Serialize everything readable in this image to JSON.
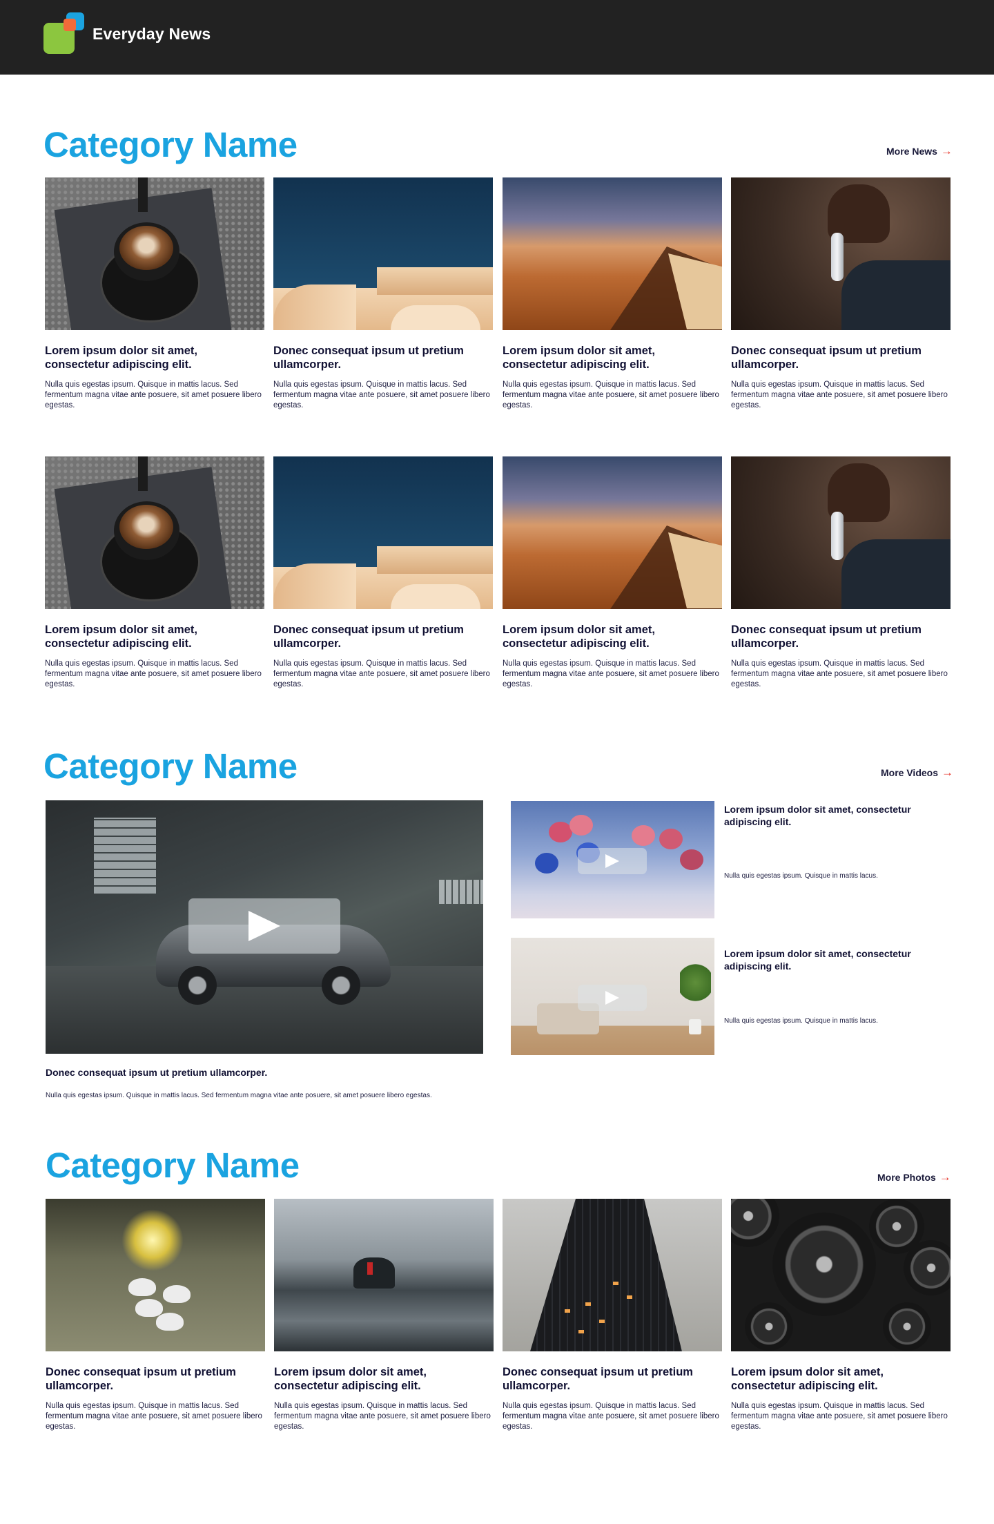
{
  "header": {
    "brand": "Everyday News"
  },
  "colors": {
    "accent": "#1aa3e0",
    "header_bg": "#222222",
    "arrow": "#e63329"
  },
  "news_section": {
    "title": "Category Name",
    "more_label": "More News",
    "rows": [
      [
        {
          "image": "coffee-cup",
          "title": "Lorem ipsum dolor sit amet, consectetur adipiscing elit.",
          "desc": "Nulla quis egestas ipsum. Quisque in mattis lacus. Sed fermentum magna vitae ante posuere, sit amet posuere libero egestas."
        },
        {
          "image": "beige-podium",
          "title": "Donec consequat ipsum ut pretium ullamcorper.",
          "desc": "Nulla quis egestas ipsum. Quisque in mattis lacus. Sed fermentum magna vitae ante posuere, sit amet posuere libero egestas."
        },
        {
          "image": "desert-dune",
          "title": "Lorem ipsum dolor sit amet, consectetur adipiscing elit.",
          "desc": "Nulla quis egestas ipsum. Quisque in mattis lacus. Sed fermentum magna vitae ante posuere, sit amet posuere libero egestas."
        },
        {
          "image": "hand-with-key",
          "title": "Donec consequat ipsum ut pretium ullamcorper.",
          "desc": "Nulla quis egestas ipsum. Quisque in mattis lacus. Sed fermentum magna vitae ante posuere, sit amet posuere libero egestas."
        }
      ],
      [
        {
          "image": "coffee-cup",
          "title": "Lorem ipsum dolor sit amet, consectetur adipiscing elit.",
          "desc": "Nulla quis egestas ipsum. Quisque in mattis lacus. Sed fermentum magna vitae ante posuere, sit amet posuere libero egestas."
        },
        {
          "image": "beige-podium",
          "title": "Donec consequat ipsum ut pretium ullamcorper.",
          "desc": "Nulla quis egestas ipsum. Quisque in mattis lacus. Sed fermentum magna vitae ante posuere, sit amet posuere libero egestas."
        },
        {
          "image": "desert-dune",
          "title": "Lorem ipsum dolor sit amet, consectetur adipiscing elit.",
          "desc": "Nulla quis egestas ipsum. Quisque in mattis lacus. Sed fermentum magna vitae ante posuere, sit amet posuere libero egestas."
        },
        {
          "image": "hand-with-key",
          "title": "Donec consequat ipsum ut pretium ullamcorper.",
          "desc": "Nulla quis egestas ipsum. Quisque in mattis lacus. Sed fermentum magna vitae ante posuere, sit amet posuere libero egestas."
        }
      ]
    ]
  },
  "videos_section": {
    "title": "Category Name",
    "more_label": "More Videos",
    "main": {
      "image": "car-in-warehouse",
      "title": "Donec consequat ipsum ut pretium ullamcorper.",
      "desc": "Nulla quis egestas ipsum. Quisque in mattis lacus. Sed fermentum magna vitae ante posuere, sit amet posuere libero egestas."
    },
    "side": [
      {
        "image": "flowers-sky",
        "title": "Lorem ipsum dolor sit amet, consectetur adipiscing elit.",
        "desc": "Nulla quis egestas ipsum. Quisque in mattis lacus."
      },
      {
        "image": "living-room",
        "title": "Lorem ipsum dolor sit amet, consectetur adipiscing elit.",
        "desc": "Nulla quis egestas ipsum. Quisque in mattis lacus."
      }
    ]
  },
  "photos_section": {
    "title": "Category Name",
    "more_label": "More Photos",
    "cards": [
      {
        "image": "chandelier",
        "title": "Donec consequat ipsum ut pretium ullamcorper.",
        "desc": "Nulla quis egestas ipsum. Quisque in mattis lacus. Sed fermentum magna vitae ante posuere, sit amet posuere libero egestas."
      },
      {
        "image": "beach-rock",
        "title": "Lorem ipsum dolor sit amet, consectetur adipiscing elit.",
        "desc": "Nulla quis egestas ipsum. Quisque in mattis lacus. Sed fermentum magna vitae ante posuere, sit amet posuere libero egestas."
      },
      {
        "image": "foggy-tower",
        "title": "Donec consequat ipsum ut pretium ullamcorper.",
        "desc": "Nulla quis egestas ipsum. Quisque in mattis lacus. Sed fermentum magna vitae ante posuere, sit amet posuere libero egestas."
      },
      {
        "image": "speakers",
        "title": "Lorem ipsum dolor sit amet, consectetur adipiscing elit.",
        "desc": "Nulla quis egestas ipsum. Quisque in mattis lacus. Sed fermentum magna vitae ante posuere, sit amet posuere libero egestas."
      }
    ]
  }
}
